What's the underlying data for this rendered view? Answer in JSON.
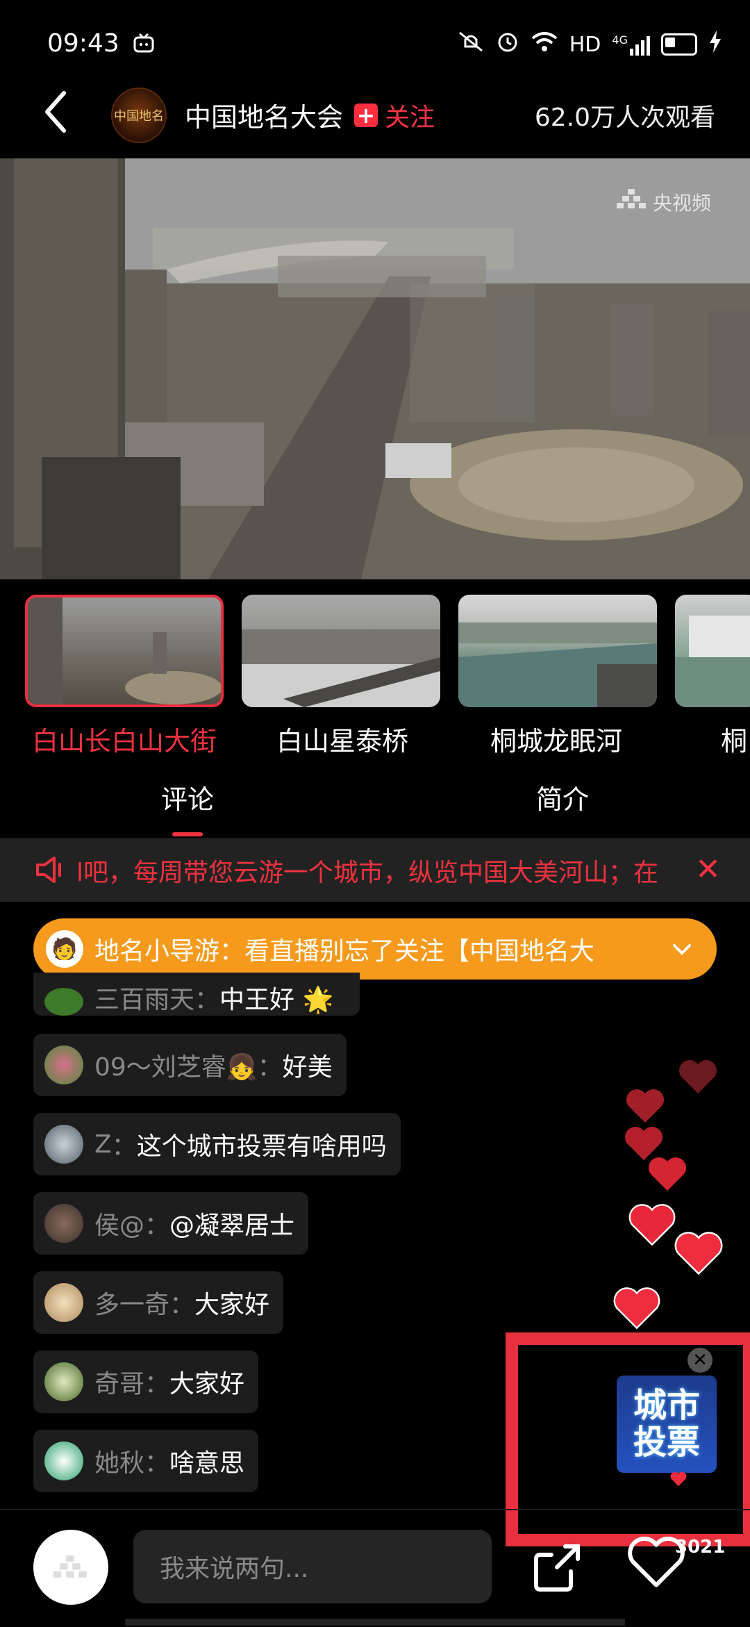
{
  "status_bar": {
    "time": "09:43",
    "network": "HD",
    "signal": "4G"
  },
  "header": {
    "channel_name": "中国地名大会",
    "follow_label": "关注",
    "viewers": "62.0万人次观看",
    "avatar_text": "中国地名"
  },
  "video": {
    "watermark": "央视频"
  },
  "thumbnails": [
    {
      "label": "白山长白山大街"
    },
    {
      "label": "白山星泰桥"
    },
    {
      "label": "桐城龙眠河"
    },
    {
      "label": "桐"
    }
  ],
  "tabs": {
    "comments": "评论",
    "intro": "简介"
  },
  "announcement": {
    "text": "l吧，每周带您云游一个城市，纵览中国大美河山；在"
  },
  "guide": {
    "text": "地名小导游：看直播别忘了关注【中国地名大"
  },
  "comments": [
    {
      "user": "三百雨天",
      "text": "中王好 🌟"
    },
    {
      "user": "09～刘芝睿👧",
      "text": "好美"
    },
    {
      "user": "Z",
      "text": "这个城市投票有啥用吗"
    },
    {
      "user": "侯@",
      "text": "@凝翠居士"
    },
    {
      "user": "多一奇",
      "text": "大家好"
    },
    {
      "user": "奇哥",
      "text": "大家好"
    },
    {
      "user": "她秋",
      "text": "啥意思"
    }
  ],
  "vote": {
    "line1": "城市",
    "line2": "投票"
  },
  "bottom_bar": {
    "input_placeholder": "我来说两句...",
    "like_count": "3021"
  },
  "colors": {
    "accent": "#f0323f",
    "guide_bg": "#f59a1c",
    "bubble_bg": "#1d1d1d"
  }
}
